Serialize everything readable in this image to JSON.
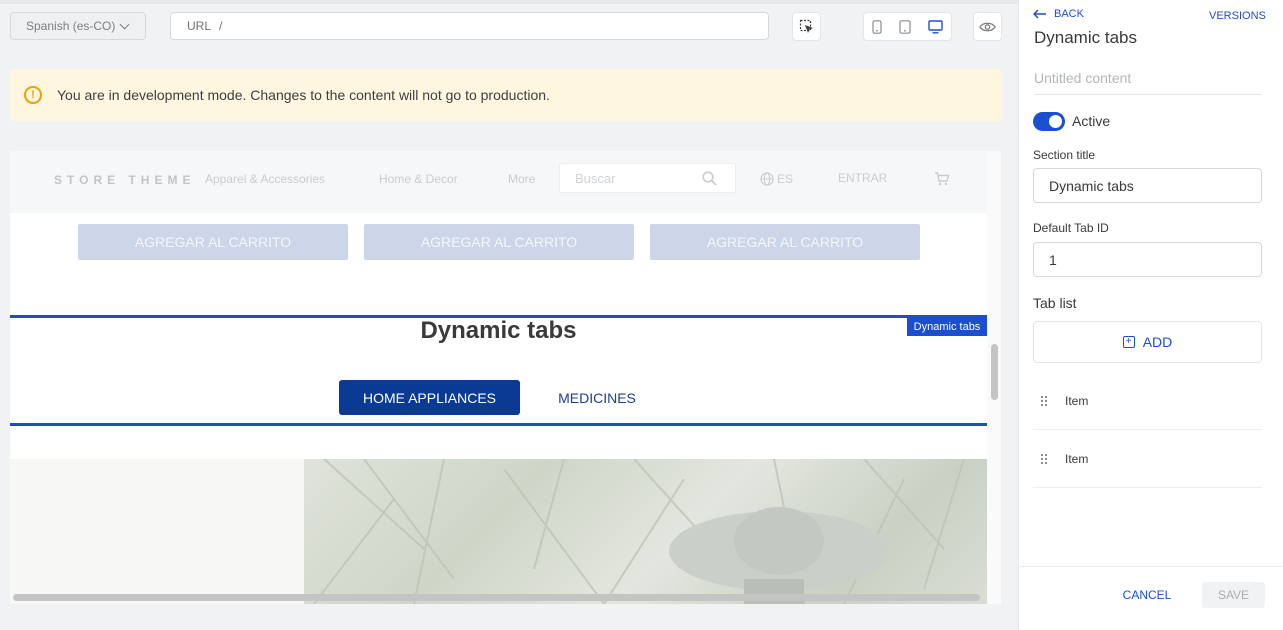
{
  "toolbar": {
    "locale": "Spanish (es-CO)",
    "url_label": "URL",
    "url_value": "/"
  },
  "banner": {
    "message": "You are in development mode. Changes to the content will not go to production."
  },
  "preview": {
    "store": {
      "logo": "STORE THEME",
      "nav": [
        "Apparel & Accessories",
        "Home & Decor",
        "More"
      ],
      "search_placeholder": "Buscar",
      "language": "ES",
      "login": "ENTRAR"
    },
    "add_to_cart_buttons": [
      "AGREGAR AL CARRITO",
      "AGREGAR AL CARRITO",
      "AGREGAR AL CARRITO"
    ],
    "block_tag": "Dynamic tabs",
    "section_title": "Dynamic tabs",
    "tabs": [
      {
        "label": "HOME APPLIANCES",
        "active": true
      },
      {
        "label": "MEDICINES",
        "active": false
      }
    ]
  },
  "panel": {
    "back": "BACK",
    "versions": "VERSIONS",
    "title": "Dynamic tabs",
    "content_name_placeholder": "Untitled content",
    "active_label": "Active",
    "active": true,
    "section_title_label": "Section title",
    "section_title_value": "Dynamic tabs",
    "default_tab_label": "Default Tab ID",
    "default_tab_value": "1",
    "tab_list_label": "Tab list",
    "add_label": "ADD",
    "items": [
      "Item",
      "Item"
    ],
    "cancel": "CANCEL",
    "save": "SAVE"
  },
  "colors": {
    "accent": "#1b4fd1",
    "tab_active": "#0b3a95",
    "banner_bg": "#fff6df",
    "warning": "#e6a400"
  }
}
